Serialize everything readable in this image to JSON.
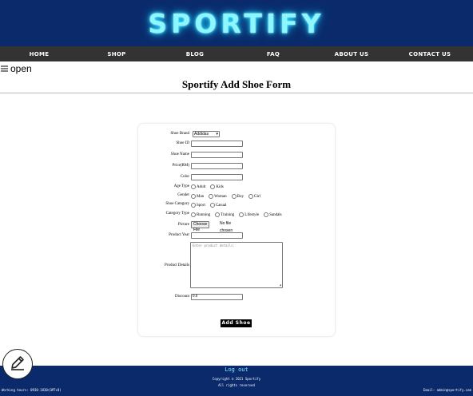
{
  "brand": {
    "logo": "SPORTIFY"
  },
  "nav": {
    "items": [
      {
        "label": "HOME"
      },
      {
        "label": "SHOP"
      },
      {
        "label": "BLOG"
      },
      {
        "label": "FAQ"
      },
      {
        "label": "ABOUT US"
      },
      {
        "label": "CONTACT US"
      }
    ]
  },
  "sidebar_toggle": {
    "icon": "hamburger-icon",
    "label": "open"
  },
  "page": {
    "title": "Sportify Add Shoe Form"
  },
  "form": {
    "shoe_brand": {
      "label": "Shoe Brand",
      "selected": "Addidas"
    },
    "shoe_id": {
      "label": "Shoe ID",
      "value": ""
    },
    "shoe_name": {
      "label": "Shoe Name",
      "value": ""
    },
    "price": {
      "label": "Price(RM)",
      "value": ""
    },
    "color": {
      "label": "Color",
      "value": ""
    },
    "age_type": {
      "label": "Age Type",
      "options": [
        "Adult",
        "Kids"
      ]
    },
    "gender": {
      "label": "Gender",
      "options": [
        "Man",
        "Woman",
        "Boy",
        "Girl"
      ]
    },
    "shoe_category": {
      "label": "Shoe Category",
      "options": [
        "Sport",
        "Casual"
      ]
    },
    "category_type": {
      "label": "Category Type",
      "options": [
        "Running",
        "Training",
        "Lifestyle",
        "Sandals"
      ]
    },
    "picture": {
      "label": "Picture",
      "button": "Choose File",
      "status": "No file chosen"
    },
    "product_year": {
      "label": "Product Year",
      "value": ""
    },
    "product_details": {
      "label": "Product Details",
      "placeholder": "Enter product details:"
    },
    "discount": {
      "label": "Discount",
      "value": "0.0"
    },
    "submit_label": "Add Shoe"
  },
  "footer": {
    "logout": "Log out",
    "copyright": "Copyright © 2021 Sportify",
    "rights": "All rights reserved",
    "hours": "Working hours: 0930-1830(GMT+8)",
    "email": "Email: admin@sportify.com"
  },
  "fab": {
    "icon": "pencil-icon"
  },
  "colors": {
    "header_bg": "#0a2a6b",
    "nav_bg": "#333333",
    "logo_glow": "#2ee8ff",
    "footer_bg": "#0a2a6b",
    "logout": "#7fe6ff"
  }
}
